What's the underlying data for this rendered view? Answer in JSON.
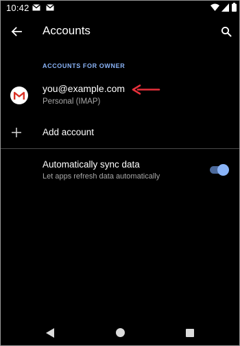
{
  "status_bar": {
    "time": "10:42",
    "notification_icons": [
      "gmail-icon",
      "gmail-icon"
    ],
    "system_icons": [
      "wifi-icon",
      "signal-icon",
      "battery-icon"
    ]
  },
  "app_bar": {
    "back_icon": "arrow-back-icon",
    "title": "Accounts",
    "search_icon": "search-icon"
  },
  "section": {
    "header": "ACCOUNTS FOR OWNER"
  },
  "accounts": [
    {
      "icon": "gmail-icon",
      "email": "you@example.com",
      "type": "Personal (IMAP)"
    }
  ],
  "add_account": {
    "icon": "plus-icon",
    "label": "Add account"
  },
  "sync": {
    "title": "Automatically sync data",
    "subtitle": "Let apps refresh data automatically",
    "enabled": true
  },
  "annotation": {
    "color": "#e8303b"
  },
  "colors": {
    "accent": "#8ab4f8",
    "background": "#000000",
    "gmail_red": "#d93025"
  },
  "nav_bar": {
    "icons": [
      "nav-back-icon",
      "nav-home-icon",
      "nav-recents-icon"
    ]
  }
}
